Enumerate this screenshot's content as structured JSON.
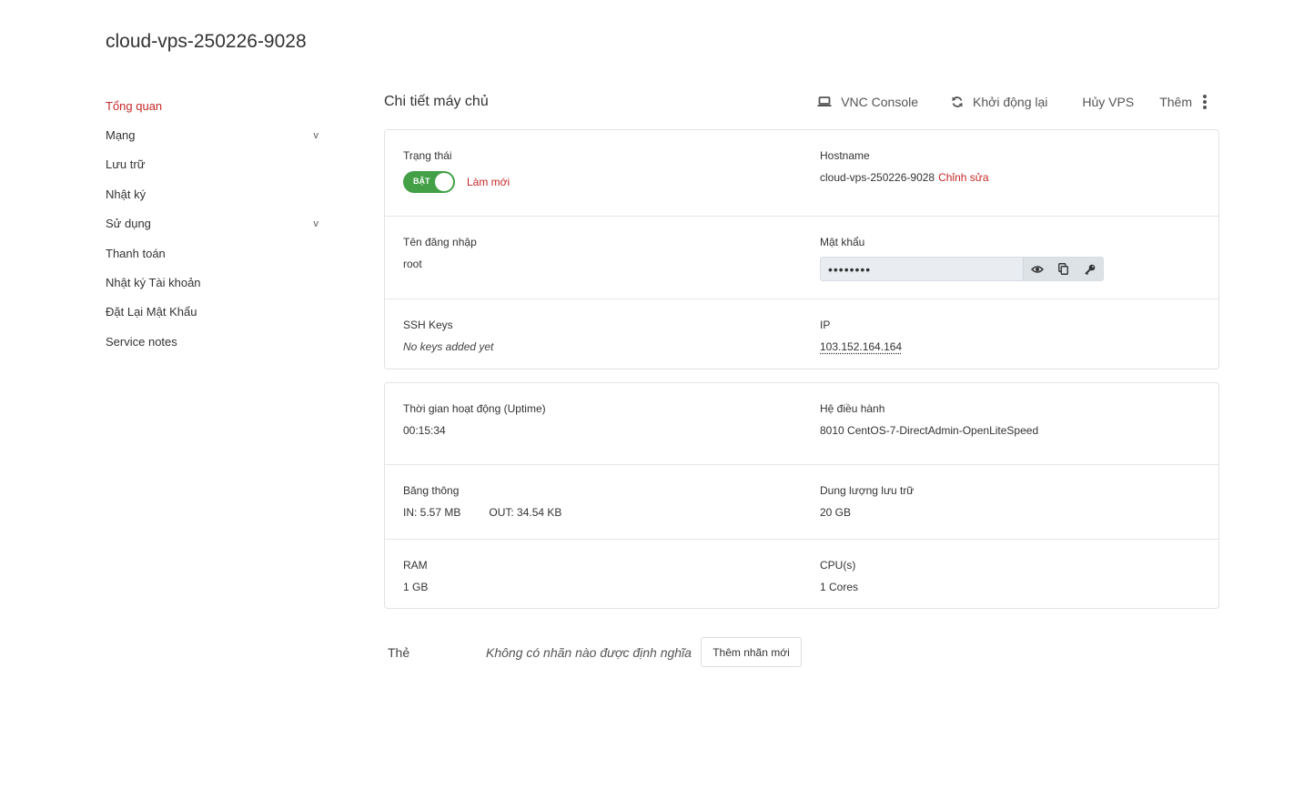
{
  "page": {
    "title": "cloud-vps-250226-9028"
  },
  "sidebar": {
    "items": [
      {
        "label": "Tổng quan",
        "active": true,
        "chevron": ""
      },
      {
        "label": "Mạng",
        "chevron": "v"
      },
      {
        "label": "Lưu trữ",
        "chevron": ""
      },
      {
        "label": "Nhật ký",
        "chevron": ""
      },
      {
        "label": "Sử dụng",
        "chevron": "v"
      },
      {
        "label": "Thanh toán",
        "chevron": ""
      },
      {
        "label": "Nhật ký Tài khoản",
        "chevron": ""
      },
      {
        "label": "Đặt Lại Mật Khẩu",
        "chevron": ""
      },
      {
        "label": "Service notes",
        "chevron": ""
      }
    ]
  },
  "header": {
    "section_title": "Chi tiết máy chủ",
    "actions": {
      "vnc": {
        "label": "VNC Console",
        "icon": "laptop-icon"
      },
      "restart": {
        "label": "Khởi động lại",
        "icon": "refresh-icon"
      },
      "cancel": {
        "label": "Hủy VPS"
      },
      "more": {
        "label": "Thêm",
        "icon": "kebab-menu-icon"
      }
    }
  },
  "details": {
    "status": {
      "label": "Trạng thái",
      "toggle_text": "BẬT",
      "toggle_on": true,
      "refresh_label": "Làm mới",
      "color": "#43a047"
    },
    "hostname": {
      "label": "Hostname",
      "value": "cloud-vps-250226-9028",
      "edit_label": "Chỉnh sửa"
    },
    "username": {
      "label": "Tên đăng nhập",
      "value": "root"
    },
    "password": {
      "label": "Mật khẩu",
      "value": "••••••••",
      "icons": [
        "eye-icon",
        "copy-icon",
        "key-icon"
      ]
    },
    "ssh": {
      "label": "SSH Keys",
      "value": "No keys added yet"
    },
    "ip": {
      "label": "IP",
      "value": "103.152.164.164"
    }
  },
  "resources": {
    "uptime": {
      "label": "Thời gian hoạt động (Uptime)",
      "value": "00:15:34"
    },
    "os": {
      "label": "Hệ điều hành",
      "value": "8010 CentOS-7-DirectAdmin-OpenLiteSpeed"
    },
    "bandwidth": {
      "label": "Băng thông",
      "in": "IN: 5.57 MB",
      "out": "OUT: 34.54 KB"
    },
    "storage": {
      "label": "Dung lượng lưu trữ",
      "value": "20 GB"
    },
    "ram": {
      "label": "RAM",
      "value": "1 GB"
    },
    "cpu": {
      "label": "CPU(s)",
      "value": "1 Cores"
    }
  },
  "tags": {
    "label": "Thẻ",
    "empty_text": "Không có nhãn nào được định nghĩa",
    "add_button": "Thêm nhãn mới"
  },
  "colors": {
    "accent": "#c62828",
    "toggle_on": "#43a047",
    "border": "#e3e3e3"
  }
}
